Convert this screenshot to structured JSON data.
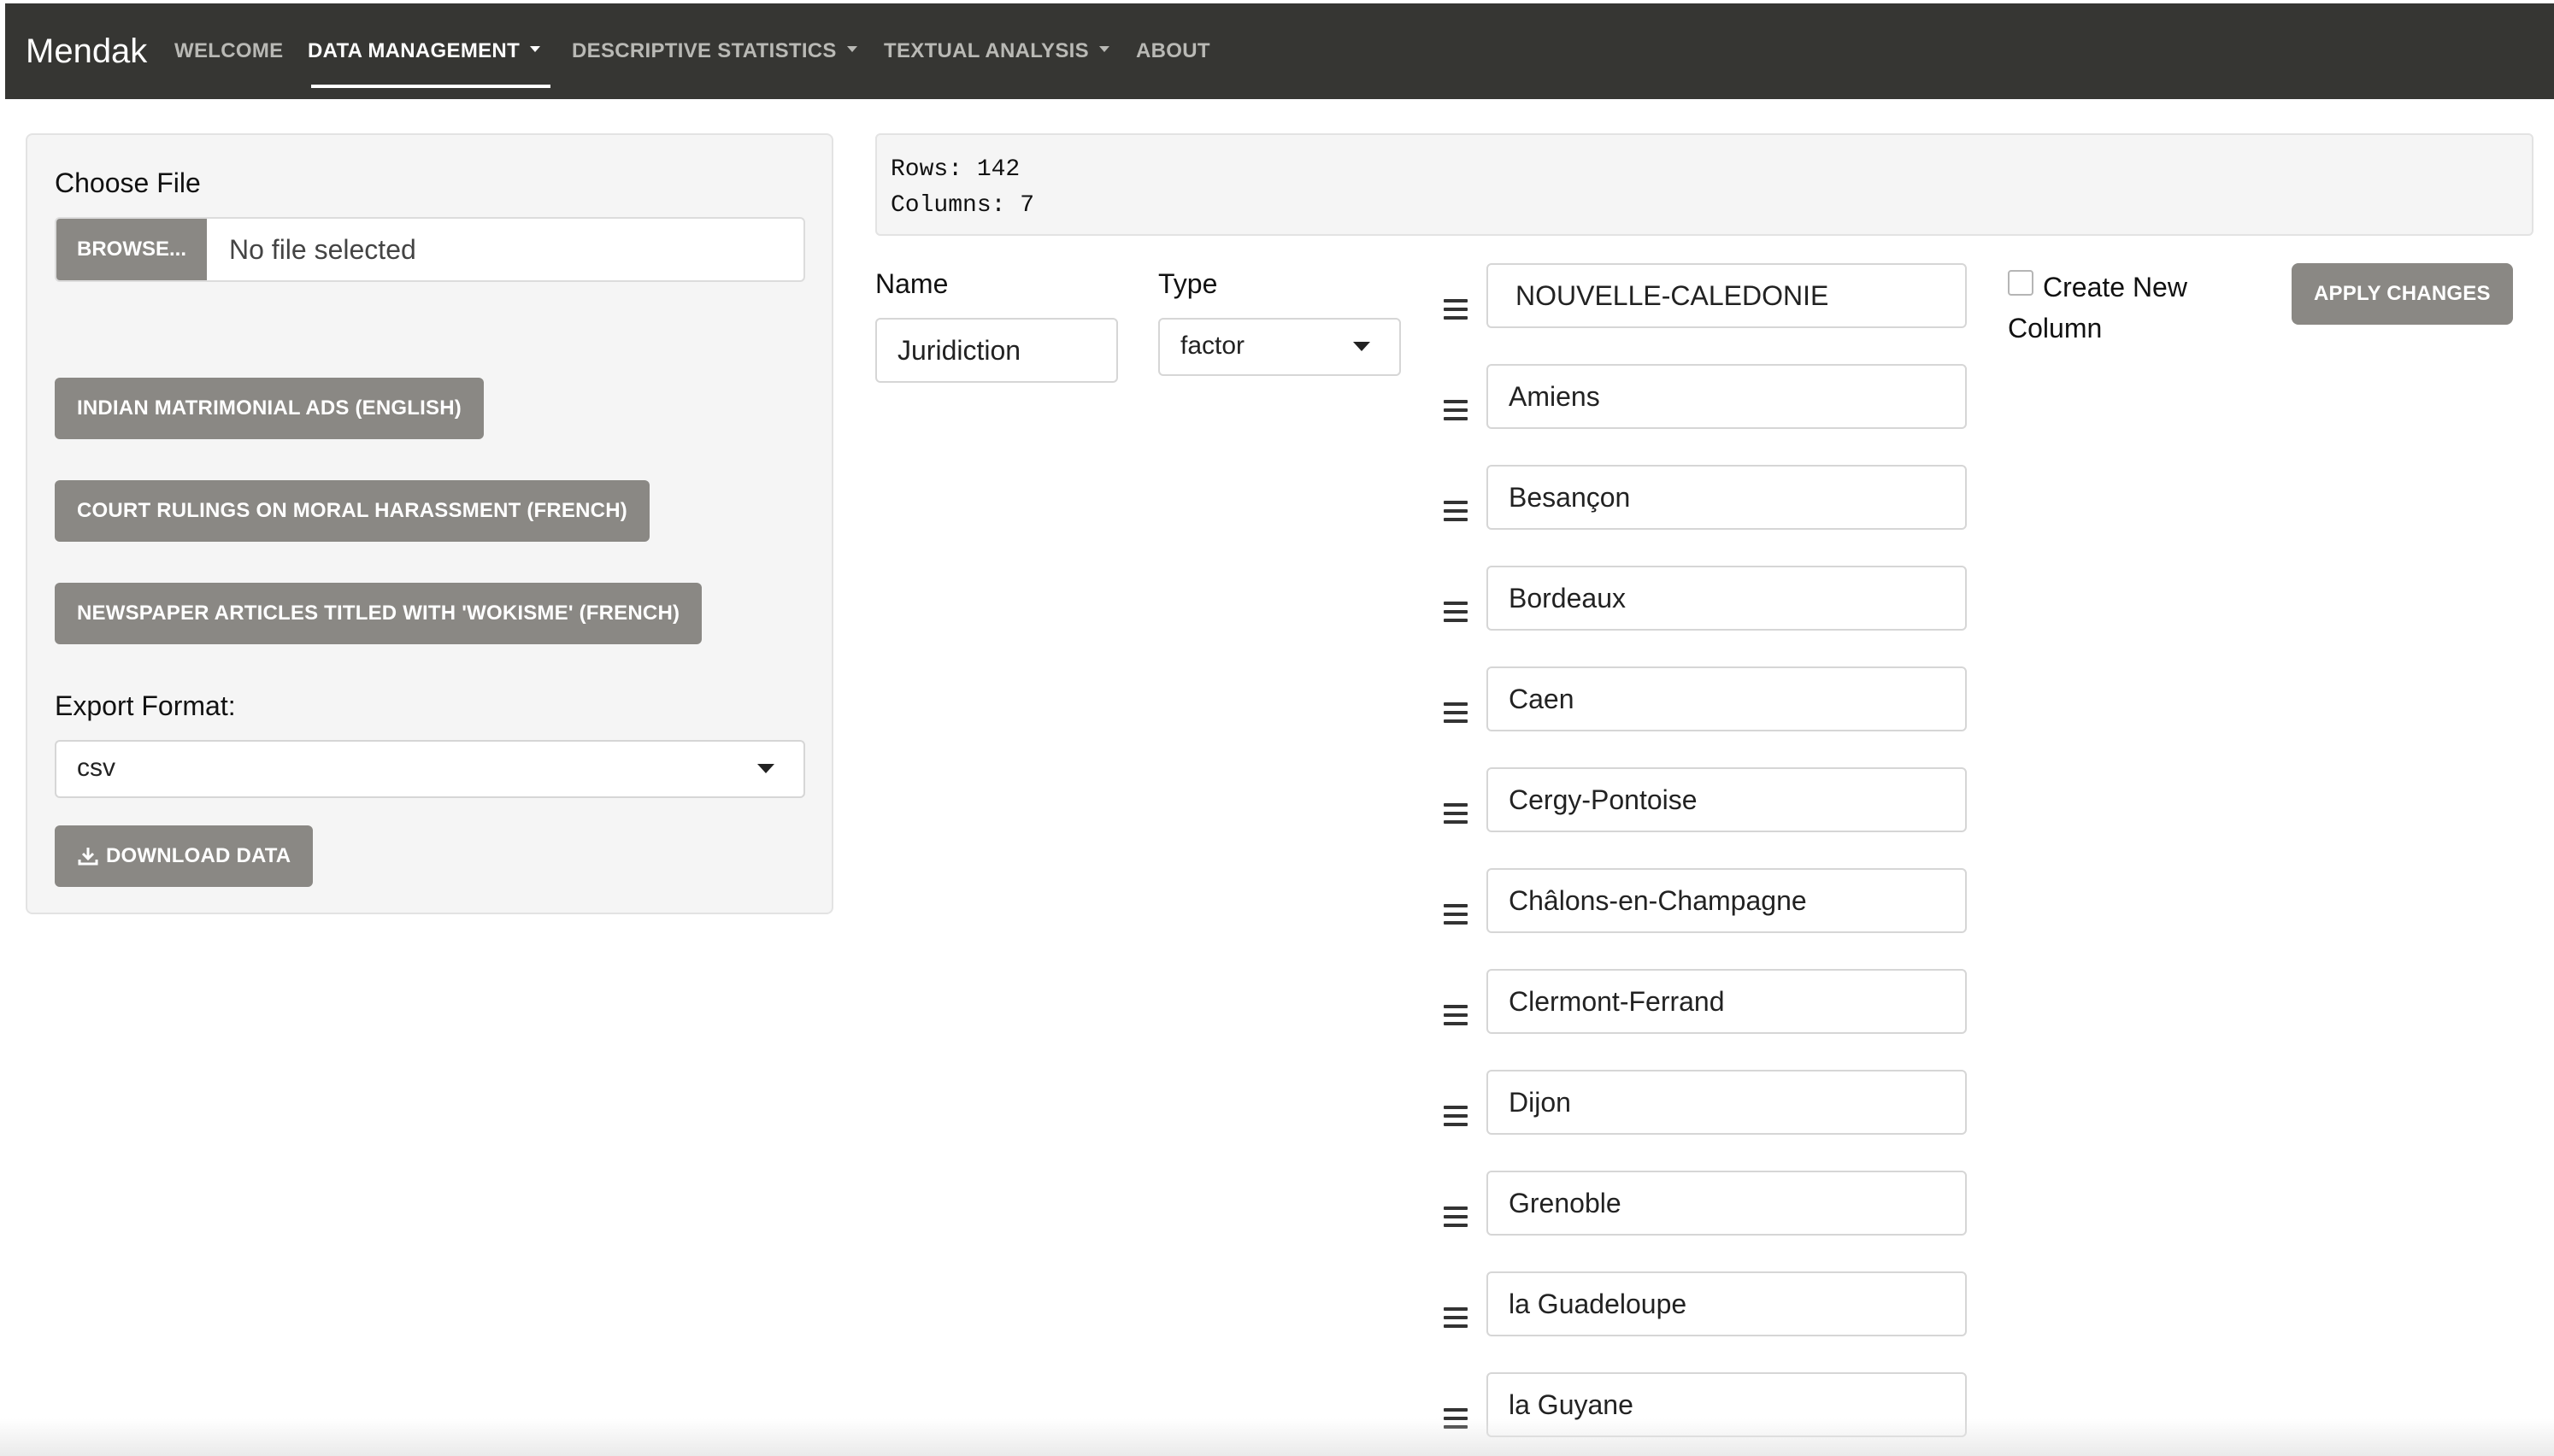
{
  "navbar": {
    "brand": "Mendak",
    "items": [
      {
        "label": "WELCOME"
      },
      {
        "label": "DATA MANAGEMENT"
      },
      {
        "label": "DESCRIPTIVE STATISTICS"
      },
      {
        "label": "TEXTUAL ANALYSIS"
      },
      {
        "label": "ABOUT"
      }
    ],
    "active_item": "DATA MANAGEMENT"
  },
  "sidebar": {
    "choose_file_label": "Choose File",
    "browse_label": "BROWSE...",
    "file_status": "No file selected",
    "sample_buttons": [
      {
        "label": "INDIAN MATRIMONIAL ADS (ENGLISH)"
      },
      {
        "label": "COURT RULINGS ON MORAL HARASSMENT (FRENCH)"
      },
      {
        "label": "NEWSPAPER ARTICLES TITLED WITH 'WOKISME' (FRENCH)"
      }
    ],
    "export_format_label": "Export Format:",
    "export_format_value": "csv",
    "download_label": "DOWNLOAD DATA"
  },
  "dataset_info": {
    "rows_line": "Rows: 142",
    "columns_line": "Columns: 7"
  },
  "column_editor": {
    "name_label": "Name",
    "name_value": "Juridiction",
    "type_label": "Type",
    "type_value": "factor",
    "levels": [
      "NOUVELLE-CALEDONIE",
      "Amiens",
      "Besançon",
      "Bordeaux",
      "Caen",
      "Cergy-Pontoise",
      "Châlons-en-Champagne",
      "Clermont-Ferrand",
      "Dijon",
      "Grenoble",
      "la Guadeloupe",
      "la Guyane"
    ],
    "create_new_column_label": "Create New Column",
    "create_new_column_checked": false,
    "apply_label": "APPLY CHANGES"
  },
  "colors": {
    "navbar_bg": "#363633",
    "button_grey": "#8a8884",
    "panel_bg": "#f5f5f5"
  }
}
